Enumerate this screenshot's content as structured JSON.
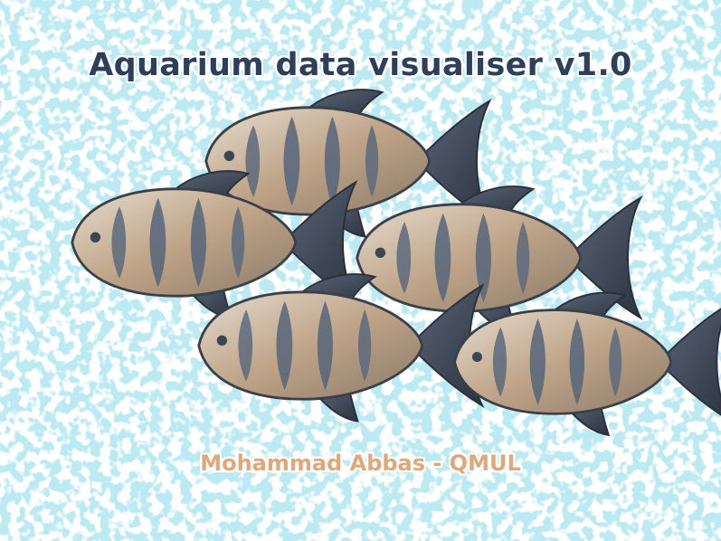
{
  "splash": {
    "title": "Aquarium data visualiser v1.0",
    "author": "Mohammad Abbas - QMUL"
  },
  "colors": {
    "water": "#7fd0e4",
    "title": "#2e3f5c",
    "author": "#e0a878",
    "fish_body": "#c9b49a",
    "fish_stripe": "#4e5f72",
    "fish_fin": "#3b4656"
  },
  "icons": [
    "fish-icon"
  ]
}
